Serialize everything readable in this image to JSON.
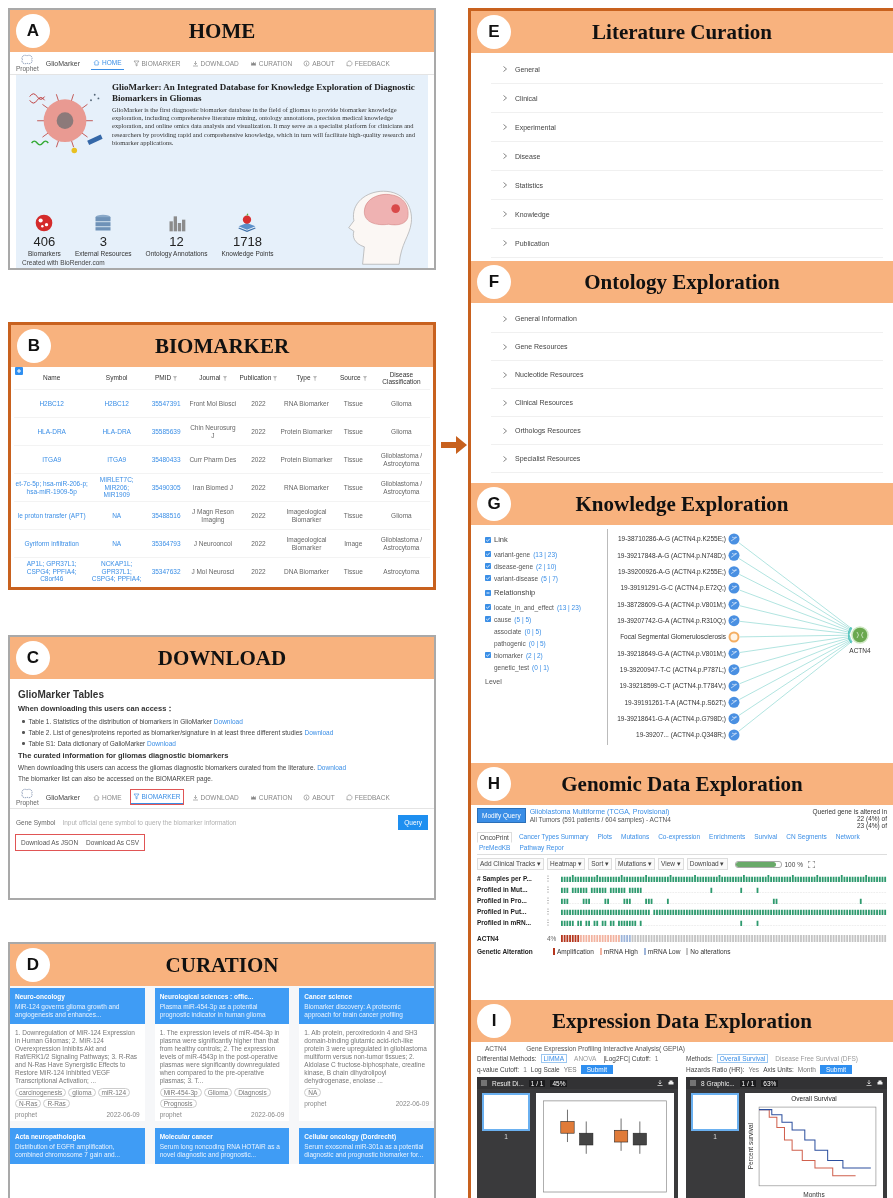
{
  "home": {
    "letter": "A",
    "title": "HOME",
    "nav": {
      "logo_caption": "Prophet",
      "brand": "GlioMarker",
      "items": [
        {
          "label": "HOME",
          "selected": true
        },
        {
          "label": "BIOMARKER",
          "selected": false
        },
        {
          "label": "DOWNLOAD",
          "selected": false
        },
        {
          "label": "CURATION",
          "selected": false
        },
        {
          "label": "ABOUT",
          "selected": false
        },
        {
          "label": "FEEDBACK",
          "selected": false
        }
      ]
    },
    "heading": "GlioMarker: An Integrated Database for Knowledge Exploration of Diagnostic Biomarkers in Gliomas",
    "description": "GlioMarker is the first diagnostic biomarker database in the field of gliomas to provide biomarker knowledge exploration, including comprehensive literature mining, ontology annotations, precision medical knowledge exploration, and online omics data analysis and visualization. It may serve as a specialist platform for clinicians and researchers by providing rapid and comprehensive knowledge, which in turn will facilitate high-quality research and biomarker applications.",
    "stats": [
      {
        "value": "406",
        "label": "Biomarkers"
      },
      {
        "value": "3",
        "label": "External Resources"
      },
      {
        "value": "12",
        "label": "Ontology Annotations"
      },
      {
        "value": "1718",
        "label": "Knowledge Points"
      }
    ],
    "credit": "Created with BioRender.com"
  },
  "biomarker": {
    "letter": "B",
    "title": "BIOMARKER",
    "columns": [
      {
        "label": "Name",
        "link": true,
        "filterable": false
      },
      {
        "label": "Symbol",
        "link": true,
        "filterable": false
      },
      {
        "label": "PMID",
        "link": true,
        "filterable": true
      },
      {
        "label": "Journal",
        "link": false,
        "filterable": true
      },
      {
        "label": "Publication",
        "link": false,
        "filterable": true
      },
      {
        "label": "Type",
        "link": false,
        "filterable": true
      },
      {
        "label": "Source",
        "link": false,
        "filterable": true
      },
      {
        "label": "Disease Classification",
        "link": false,
        "filterable": false
      }
    ],
    "rows": [
      [
        "H2BC12",
        "H2BC12",
        "35547391",
        "Front Mol Biosci",
        "2022",
        "RNA Biomarker",
        "Tissue",
        "Glioma"
      ],
      [
        "HLA-DRA",
        "HLA-DRA",
        "35585639",
        "Chin Neurosurg J",
        "2022",
        "Protein Biomarker",
        "Tissue",
        "Glioma"
      ],
      [
        "ITGA9",
        "ITGA9",
        "35480433",
        "Curr Pharm Des",
        "2022",
        "Protein Biomarker",
        "Tissue",
        "Glioblastoma / Astrocytoma"
      ],
      [
        "et-7c-5p; hsa-miR-206-p; hsa-miR-1909-5p",
        "MIRLET7C; MIR206; MIR1909",
        "35490305",
        "Iran Biomed J",
        "2022",
        "RNA Biomarker",
        "Tissue",
        "Glioblastoma / Astrocytoma"
      ],
      [
        "le proton transfer (APT)",
        "NA",
        "35488516",
        "J Magn Reson Imaging",
        "2022",
        "Imageological Biomarker",
        "Tissue",
        "Glioma"
      ],
      [
        "Gyriform infiltration",
        "NA",
        "35364793",
        "J Neurooncol",
        "2022",
        "Imageological Biomarker",
        "Image",
        "Glioblastoma / Astrocytoma"
      ],
      [
        "AP1L; GPR37L1; CSPG4; PPFIA4; C8orf46",
        "NCKAP1L; GPR37L1; CSPG4; PPFIA4;",
        "35347632",
        "J Mol Neurosci",
        "2022",
        "DNA Biomarker",
        "Tissue",
        "Astrocytoma"
      ]
    ]
  },
  "download": {
    "letter": "C",
    "title": "DOWNLOAD",
    "heading": "GlioMarker Tables",
    "subheading": "When downloading this users can access：",
    "tables": [
      {
        "text": "Table 1. Statistics of the distribution of biomarkers in GlioMarker",
        "link": "Download"
      },
      {
        "text": "Table 2. List of genes/proteins reported as biomarker/signature in at least three different studies",
        "link": "Download"
      },
      {
        "text": "Table S1: Data dictionary of GalioMarker",
        "link": "Download"
      }
    ],
    "curated_heading": "The curated information for gliomas diagnostic biomarkers",
    "curated_text": "When downloading this users can access the gliomas diagnostic biomarkers curated from the literature.",
    "curated_link": "Download",
    "note": "The biomarker list can also be accessed on the BIOMARKER page.",
    "nav": {
      "logo_caption": "Prophet",
      "brand": "GlioMarker",
      "items": [
        {
          "label": "HOME",
          "selected": false,
          "highlighted": false
        },
        {
          "label": "BIOMARKER",
          "selected": true,
          "highlighted": true
        },
        {
          "label": "DOWNLOAD",
          "selected": false,
          "highlighted": false
        },
        {
          "label": "CURATION",
          "selected": false,
          "highlighted": false
        },
        {
          "label": "ABOUT",
          "selected": false,
          "highlighted": false
        },
        {
          "label": "FEEDBACK",
          "selected": false,
          "highlighted": false
        }
      ]
    },
    "search": {
      "label": "Gene Symbol",
      "placeholder": "Input official gene symbol to query the biomarker information",
      "query": "Query",
      "exports": [
        "Download As JSON",
        "Download As CSV"
      ],
      "exports_highlighted": true
    }
  },
  "curation": {
    "letter": "D",
    "title": "CURATION",
    "cards": [
      {
        "journal": "Neuro-oncology",
        "title": "MiR-124 governs glioma growth and angiogenesis and enhances...",
        "body": "1. Downregulation of MiR-124 Expression in Human Gliomas; 2. MiR-124 Overexpression Inhibits Akt and Raf/ERK1/2 Signaling Pathways; 3. R-Ras and N-Ras Have Synergistic Effects to Restore MiR-124 Inhibited VEGF Transcriptional Activation; ...",
        "tags": [
          "carcinogenesis",
          "glioma",
          "miR-124",
          "N-Ras",
          "R-Ras"
        ],
        "author": "prophet",
        "date": "2022-06-09"
      },
      {
        "journal": "Neurological sciences : offic...",
        "title": "Plasma miR-454-3p as a potential prognostic indicator in human glioma",
        "body": "1. The expression levels of miR-454-3p in plasma were significantly higher than that from healthy controls; 2. The expression levels of miR-4543p in the post-operative plasmas were significantly downregulated when compared to the pre-operative plasmas; 3. T...",
        "tags": [
          "MiR-454-3p",
          "Glioma",
          "Diagnosis",
          "Prognosis"
        ],
        "author": "prophet",
        "date": "2022-06-09"
      },
      {
        "journal": "Cancer science",
        "title": "Biomarker discovery: A proteomic approach for brain cancer profiling",
        "body": "1. Alb protein, peroxiredoxin 4 and SH3 domain-binding glutamic acid-rich-like protein 3 were upregulated in glioblastoma multiform versus non-tumor tissues; 2. Aldolase C fructose-biphosphate, creatine kinase, B chain dihydrolipoyl dehydrogenase, enolase ...",
        "tags": [
          "NA"
        ],
        "author": "prophet",
        "date": "2022-06-09"
      },
      {
        "journal": "Acta neuropathologica",
        "title": "Distribution of EGFR amplification, combined chromosome 7 gain and..."
      },
      {
        "journal": "Molecular cancer",
        "title": "Serum long noncoding RNA HOTAIR as a novel diagnostic and prognostic..."
      },
      {
        "journal": "Cellular oncology (Dordrecht)",
        "title": "Serum exosomal miR-301a as a potential diagnostic and prognostic biomarker for..."
      }
    ]
  },
  "literature": {
    "letter": "E",
    "title": "Literature Curation",
    "items": [
      "General",
      "Clinical",
      "Experimental",
      "Disease",
      "Statistics",
      "Knowledge",
      "Publication"
    ]
  },
  "ontology": {
    "letter": "F",
    "title": "Ontology Exploration",
    "items": [
      "General Information",
      "Gene Resources",
      "Nucleotide Resources",
      "Clinical Resources",
      "Orthologs Resources",
      "Specialist Resources"
    ]
  },
  "knowledge": {
    "letter": "G",
    "title": "Knowledge Exploration",
    "filters": [
      {
        "label": "Link",
        "checked": true,
        "indeterminate": false,
        "items": [
          {
            "label": "variant-gene",
            "count": "(13 | 23)",
            "checked": true
          },
          {
            "label": "disease-gene",
            "count": "(2 | 10)",
            "checked": true
          },
          {
            "label": "variant-disease",
            "count": "(5 | 7)",
            "checked": true
          }
        ]
      },
      {
        "label": "Relationship",
        "checked": true,
        "indeterminate": true,
        "items": [
          {
            "label": "locate_in_and_effect",
            "count": "(13 | 23)",
            "checked": true
          },
          {
            "label": "cause",
            "count": "(5 | 5)",
            "checked": true
          },
          {
            "label": "associate",
            "count": "(0 | 5)",
            "checked": false
          },
          {
            "label": "pathogenic",
            "count": "(0 | 5)",
            "checked": false
          },
          {
            "label": "biomarker",
            "count": "(2 | 2)",
            "checked": true
          },
          {
            "label": "genetic_test",
            "count": "(0 | 1)",
            "checked": false
          }
        ]
      }
    ],
    "level_label": "Level",
    "center": {
      "label": "ACTN4",
      "kind": "gene"
    },
    "nodes": [
      {
        "label": "19-38710286-A-G (ACTN4.p.K255E;)",
        "kind": "variant"
      },
      {
        "label": "19-39217848-A-G (ACTN4.p.N748D;)",
        "kind": "variant"
      },
      {
        "label": "19-39200926-A-G (ACTN4.p.K255E;)",
        "kind": "variant"
      },
      {
        "label": "19-39191291-G-C (ACTN4.p.E72Q;)",
        "kind": "variant"
      },
      {
        "label": "19-38728609-G-A (ACTN4.p.V801M;)",
        "kind": "variant"
      },
      {
        "label": "19-39207742-G-A (ACTN4.p.R310Q;)",
        "kind": "variant"
      },
      {
        "label": "Focal Segmental Glomerulosclerosis",
        "kind": "disease"
      },
      {
        "label": "19-39218649-G-A (ACTN4.p.V801M;)",
        "kind": "variant"
      },
      {
        "label": "19-39200947-T-C (ACTN4.p.P787L;)",
        "kind": "variant"
      },
      {
        "label": "19-39218599-C-T (ACTN4.p.T784V;)",
        "kind": "variant"
      },
      {
        "label": "19-39191261-T-A (ACTN4.p.S62T;)",
        "kind": "variant"
      },
      {
        "label": "19-39218641-G-A (ACTN4.p.G798D;)",
        "kind": "variant"
      },
      {
        "label": "19-39207... (ACTN4.p.Q348R;)",
        "kind": "variant"
      }
    ]
  },
  "genomic": {
    "letter": "H",
    "title": "Genomic Data Exploration",
    "modify": "Modify Query",
    "study": "Glioblastoma Multiforme (TCGA, Provisional)",
    "summary": "All Tumors (591 patients / 604 samples) - ACTN4",
    "altered_label": "Queried gene is altered in",
    "altered": [
      "22 (4%) of",
      "23 (4%) of"
    ],
    "tabs": [
      {
        "label": "OncoPrint",
        "selected": true
      },
      {
        "label": "Cancer Types Summary",
        "selected": false
      },
      {
        "label": "Plots",
        "selected": false
      },
      {
        "label": "Mutations",
        "selected": false
      },
      {
        "label": "Co-expression",
        "selected": false
      },
      {
        "label": "Enrichments",
        "selected": false
      },
      {
        "label": "Survival",
        "selected": false
      },
      {
        "label": "CN Segments",
        "selected": false
      },
      {
        "label": "Network",
        "selected": false
      },
      {
        "label": "PreMedKB",
        "selected": false
      },
      {
        "label": "Pathway Repor",
        "selected": false
      }
    ],
    "tools": [
      "Add Clinical Tracks ▾",
      "Heatmap ▾",
      "Sort ▾",
      "Mutations ▾",
      "View ▾",
      "Download ▾"
    ],
    "zoom": {
      "level": 0.9,
      "reading": "100 %"
    },
    "tracks": [
      "# Samples per P...",
      "Profiled in Mut...",
      "Profiled in Pro...",
      "Profiled in Put...",
      "Profiled in mRN..."
    ],
    "gene": {
      "label": "ACTN4",
      "percent": "4%"
    },
    "legend_title": "Genetic Alteration",
    "legend": [
      {
        "label": "Amplification",
        "color": "#b5361d"
      },
      {
        "label": "mRNA High",
        "color": "#f2b3a0"
      },
      {
        "label": "mRNA Low",
        "color": "#9db5da"
      },
      {
        "label": "No alterations",
        "color": "#c4c4c4"
      }
    ]
  },
  "expression": {
    "letter": "I",
    "title": "Expression Data Exploration",
    "gene": "ACTN4",
    "tool": "Gene Expression Profiling Interactive Analysis( GEPIA)",
    "panels": [
      {
        "lines": [
          {
            "items": [
              {
                "kind": "label",
                "text": "Differential Methods:"
              },
              {
                "kind": "option",
                "text": "LIMMA",
                "selected": true
              },
              {
                "kind": "option",
                "text": "ANOVA",
                "selected": false
              },
              {
                "kind": "label",
                "text": "|Log2FC| Cutoff:"
              },
              {
                "kind": "value",
                "text": "1"
              }
            ]
          },
          {
            "items": [
              {
                "kind": "label",
                "text": "q-value Cutoff:"
              },
              {
                "kind": "value",
                "text": "1"
              },
              {
                "kind": "label",
                "text": "Log Scale"
              },
              {
                "kind": "value",
                "text": "YES"
              },
              {
                "kind": "button",
                "text": "Submit"
              }
            ]
          }
        ],
        "viewer": {
          "kind": "boxplot",
          "file": "Result Di...",
          "page": "1 / 1",
          "zoom": "45%",
          "thumb_page": "1"
        }
      },
      {
        "lines": [
          {
            "items": [
              {
                "kind": "label",
                "text": "Methods:"
              },
              {
                "kind": "option",
                "text": "Overall Survival",
                "selected": true
              },
              {
                "kind": "option",
                "text": "Disease Free Survival (DFS)",
                "selected": false
              }
            ]
          },
          {
            "items": [
              {
                "kind": "label",
                "text": "Hazards Ratio (HR):"
              },
              {
                "kind": "value",
                "text": "Yes"
              },
              {
                "kind": "label",
                "text": "Axis Units:"
              },
              {
                "kind": "value",
                "text": "Month"
              },
              {
                "kind": "button",
                "text": "Submit"
              }
            ]
          }
        ],
        "viewer": {
          "kind": "survival",
          "file": "8 Graphic...",
          "page": "1 / 1",
          "zoom": "63%",
          "thumb_page": "1",
          "plot_title": "Overall Survival",
          "xlabel": "Months",
          "ylabel": "Percent survival"
        }
      }
    ]
  }
}
